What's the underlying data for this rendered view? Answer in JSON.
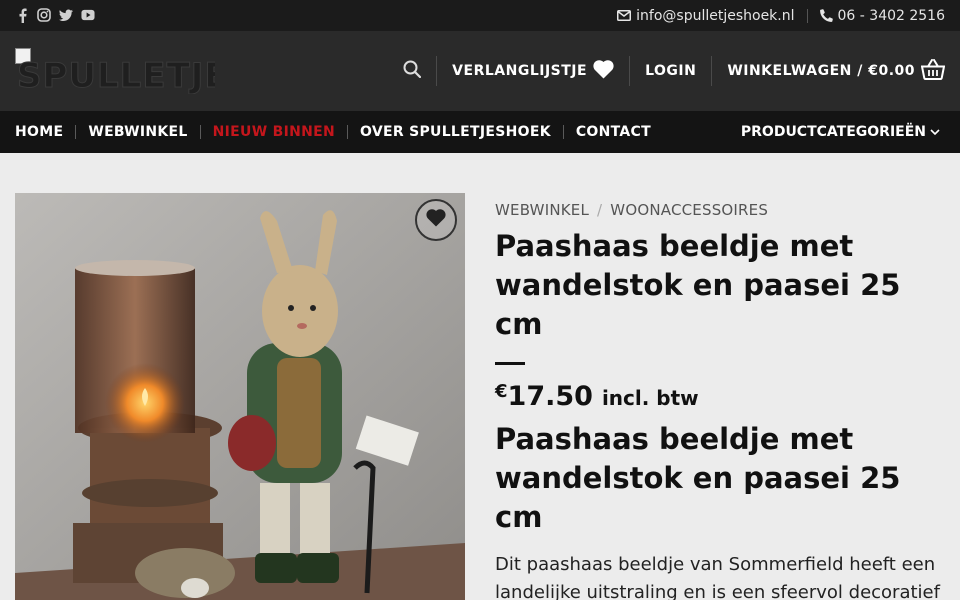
{
  "topbar": {
    "social": [
      {
        "icon": "facebook-icon"
      },
      {
        "icon": "instagram-icon"
      },
      {
        "icon": "twitter-icon"
      },
      {
        "icon": "youtube-icon"
      }
    ],
    "email": "info@spulletjeshoek.nl",
    "phone": "06 - 3402 2516"
  },
  "header": {
    "logo_text": "SPULLETJES",
    "wishlist_label": "VERLANGLIJSTJE",
    "login_label": "LOGIN",
    "cart_label": "WINKELWAGEN / €0.00"
  },
  "nav": {
    "items": [
      {
        "label": "HOME",
        "active": false
      },
      {
        "label": "WEBWINKEL",
        "active": false
      },
      {
        "label": "NIEUW BINNEN",
        "active": true
      },
      {
        "label": "OVER SPULLETJESHOEK",
        "active": false
      },
      {
        "label": "CONTACT",
        "active": false
      }
    ],
    "categories_label": "PRODUCTCATEGORIEËN"
  },
  "product": {
    "breadcrumb": [
      "WEBWINKEL",
      "WOONACCESSOIRES"
    ],
    "title": "Paashaas beeldje met wandelstok en paasei 25 cm",
    "price_currency": "€",
    "price_amount": "17.50",
    "price_tax": "incl. btw",
    "description_title": "Paashaas beeldje met wandelstok en paasei 25 cm",
    "description_lines": [
      "Dit paashaas beeldje van Sommerfield heeft een",
      "landelijke uitstraling en is een sfeervol decoratief"
    ]
  },
  "colors": {
    "topbar": "#1b1b1b",
    "header": "#2a2a2a",
    "nav": "#141414",
    "active_nav": "#c4161c",
    "page_bg": "#ececec"
  }
}
